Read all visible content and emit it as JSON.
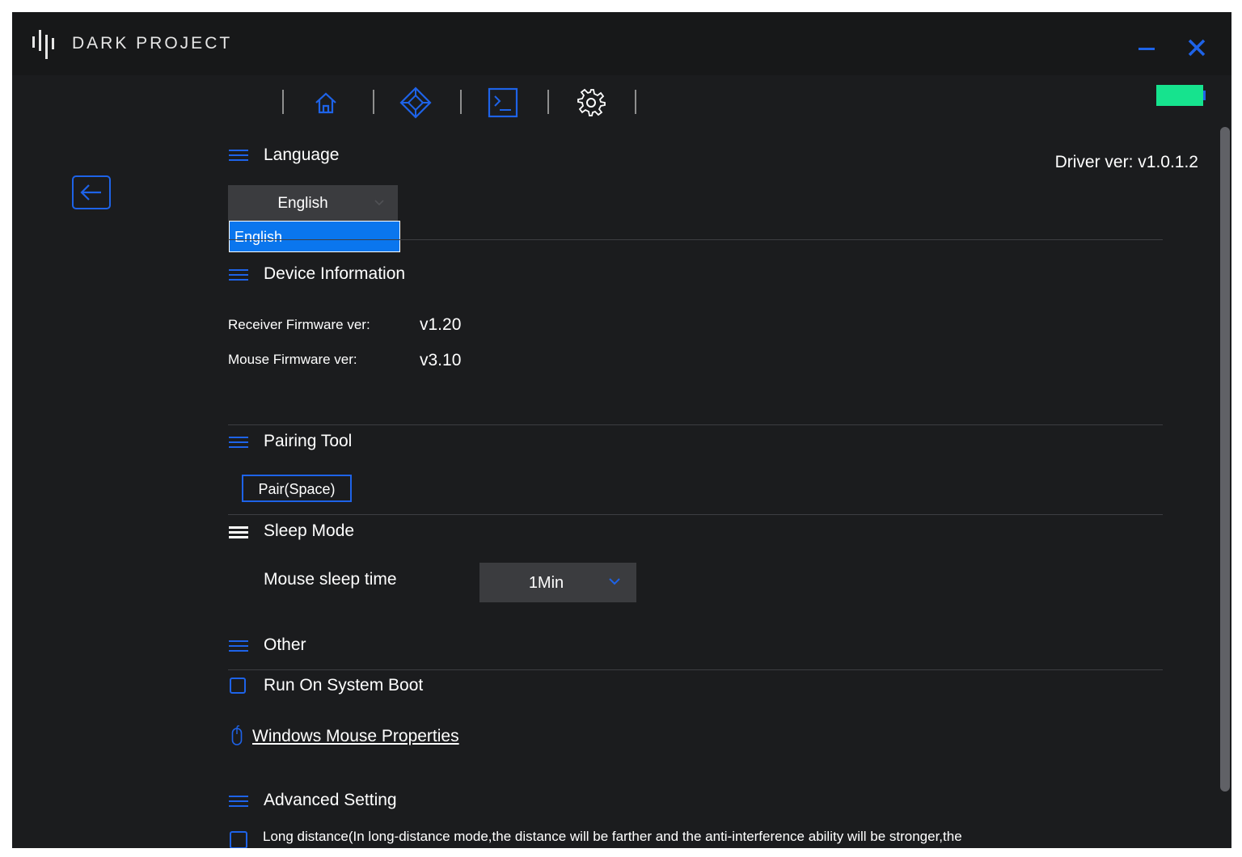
{
  "app": {
    "brand": "DARK PROJECT"
  },
  "window_controls": {
    "minimize_icon": "minimize-icon",
    "close_icon": "close-icon"
  },
  "toolbar": {
    "icons": [
      "home-icon",
      "diamond-icon",
      "terminal-icon",
      "gear-icon"
    ],
    "active": "terminal-icon"
  },
  "battery": {
    "level_fraction": 1.0,
    "color": "#16e38e"
  },
  "driver_version": "Driver ver: v1.0.1.2",
  "sections": {
    "language": {
      "title": "Language",
      "selected": "English",
      "options": [
        "English"
      ]
    },
    "device_information": {
      "title": "Device Information",
      "rows": [
        {
          "label": "Receiver Firmware ver:",
          "value": "v1.20"
        },
        {
          "label": "Mouse Firmware ver:",
          "value": "v3.10"
        }
      ]
    },
    "pairing_tool": {
      "title": "Pairing Tool",
      "button": "Pair(Space)"
    },
    "sleep_mode": {
      "title": "Sleep Mode",
      "label": "Mouse sleep time",
      "value": "1Min"
    },
    "other": {
      "title": "Other",
      "run_on_boot": "Run On System Boot",
      "mouse_properties_link": "Windows Mouse Properties"
    },
    "advanced": {
      "title": "Advanced Setting",
      "long_distance": "Long distance(In long-distance mode,the distance will be farther and the anti-interference ability will be stronger,the"
    }
  },
  "colors": {
    "accent": "#1e63e8",
    "background": "#1b1c1e",
    "dropdown_highlight": "#0a76ee"
  }
}
